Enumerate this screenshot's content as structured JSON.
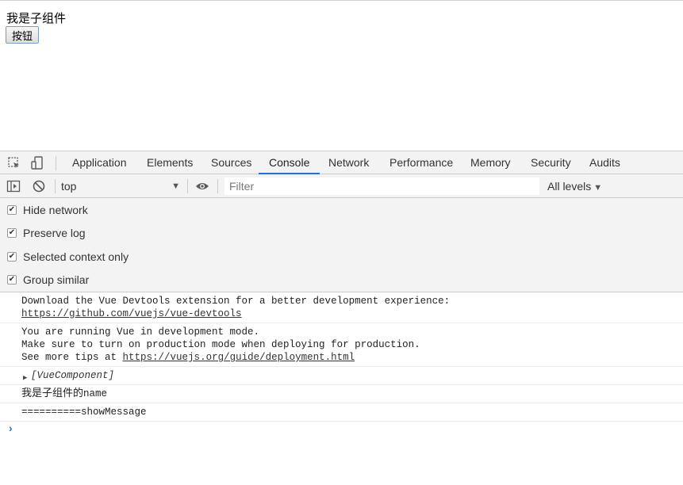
{
  "page": {
    "child_text": "我是子组件",
    "button_label": "按钮"
  },
  "devtools": {
    "tabs": [
      "Application",
      "Elements",
      "Sources",
      "Console",
      "Network",
      "Performance",
      "Memory",
      "Security",
      "Audits"
    ],
    "active_tab": "Console",
    "toolbar": {
      "context": "top",
      "filter_placeholder": "Filter",
      "levels": "All levels"
    },
    "settings": [
      {
        "label": "Hide network",
        "checked": true
      },
      {
        "label": "Preserve log",
        "checked": true
      },
      {
        "label": "Selected context only",
        "checked": true
      },
      {
        "label": "Group similar",
        "checked": true
      }
    ],
    "messages": {
      "m1_text": "Download the Vue Devtools extension for a better development experience:",
      "m1_link": "https://github.com/vuejs/vue-devtools",
      "m2_line1": "You are running Vue in development mode.",
      "m2_line2": "Make sure to turn on production mode when deploying for production.",
      "m2_line3_prefix": "See more tips at",
      "m2_link": "https://vuejs.org/guide/deployment.html",
      "m3_object": "[VueComponent]",
      "m4_cjk": "我是子组件的",
      "m4_ascii": "name",
      "m5_text": "==========showMessage"
    },
    "prompt_symbol": "›",
    "accent_color": "#1a73e8"
  }
}
